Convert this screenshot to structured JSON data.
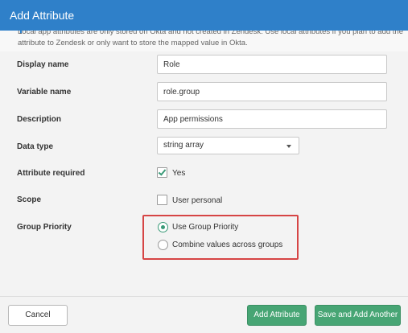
{
  "dialog": {
    "title": "Add Attribute"
  },
  "notice": {
    "text": "Local app attributes are only stored on Okta and not created in Zendesk. Use local attributes if you plan to add the attribute to Zendesk or only want to store the mapped value in Okta."
  },
  "fields": {
    "display_name": {
      "label": "Display name",
      "value": "Role"
    },
    "variable_name": {
      "label": "Variable name",
      "value": "role.group"
    },
    "description": {
      "label": "Description",
      "value": "App permissions"
    },
    "data_type": {
      "label": "Data type",
      "value": "string array"
    },
    "attribute_required": {
      "label": "Attribute required",
      "option": "Yes",
      "checked": true
    },
    "scope": {
      "label": "Scope",
      "option": "User personal",
      "checked": false
    },
    "group_priority": {
      "label": "Group Priority",
      "options": [
        "Use Group Priority",
        "Combine values across groups"
      ],
      "selected": "Use Group Priority"
    }
  },
  "footer": {
    "cancel_label": "Cancel",
    "add_label": "Add Attribute",
    "save_add_another_label": "Save and Add Another"
  },
  "colors": {
    "title_bar": "#2f80c9",
    "primary_button": "#47a574",
    "highlight_border": "#d64545",
    "check": "#3a9a78"
  }
}
